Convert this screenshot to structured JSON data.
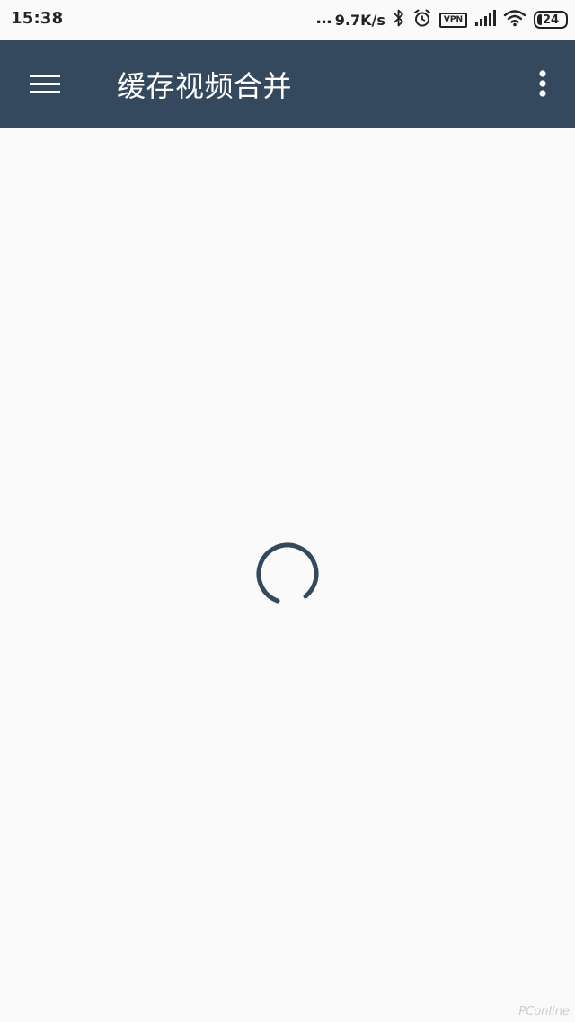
{
  "status_bar": {
    "time": "15:38",
    "dots": "...",
    "network_speed": "9.7K/s",
    "vpn_label": "VPN",
    "battery_level": "24",
    "battery_fraction": 0.24,
    "icons": [
      "bluetooth-icon",
      "alarm-icon",
      "signal-icon",
      "wifi-icon",
      "battery-icon"
    ]
  },
  "app_bar": {
    "title": "缓存视频合并",
    "background_color": "#34495e",
    "icons": [
      "menu-icon",
      "more-vert-icon"
    ]
  },
  "content": {
    "state": "loading",
    "spinner_color": "#34495e"
  },
  "watermark": {
    "text": "PConline"
  }
}
